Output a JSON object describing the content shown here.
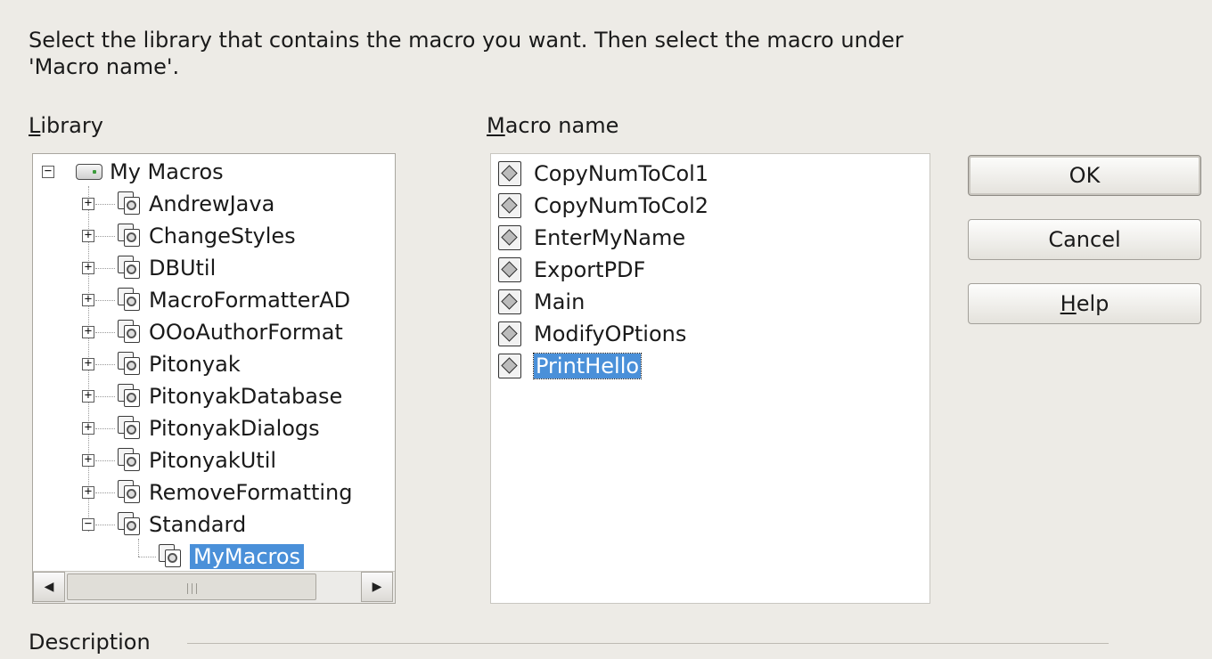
{
  "instructions": "Select the library that contains the macro you want. Then select the macro under 'Macro name'.",
  "library": {
    "label_accel": "L",
    "label_rest": "ibrary",
    "root": "My Macros",
    "items": [
      {
        "label": "AndrewJava",
        "expander": "+"
      },
      {
        "label": "ChangeStyles",
        "expander": "+"
      },
      {
        "label": "DBUtil",
        "expander": "+"
      },
      {
        "label": "MacroFormatterAD",
        "expander": "+"
      },
      {
        "label": "OOoAuthorFormat",
        "expander": "+"
      },
      {
        "label": "Pitonyak",
        "expander": "+"
      },
      {
        "label": "PitonyakDatabase",
        "expander": "+"
      },
      {
        "label": "PitonyakDialogs",
        "expander": "+"
      },
      {
        "label": "PitonyakUtil",
        "expander": "+"
      },
      {
        "label": "RemoveFormatting",
        "expander": "+"
      },
      {
        "label": "Standard",
        "expander": "−"
      }
    ],
    "child": "MyMacros",
    "root_expander": "−"
  },
  "macros": {
    "label_accel": "M",
    "label_rest": "acro name",
    "items": [
      "CopyNumToCol1",
      "CopyNumToCol2",
      "EnterMyName",
      "ExportPDF",
      "Main",
      "ModifyOPtions",
      "PrintHello"
    ],
    "selected": "PrintHello"
  },
  "buttons": {
    "ok": "OK",
    "cancel": "Cancel",
    "help_accel": "H",
    "help_rest": "elp"
  },
  "description_label": "Description",
  "scroll_glyphs": {
    "up": "▲",
    "down": "▼",
    "left": "◀",
    "right": "▶"
  }
}
